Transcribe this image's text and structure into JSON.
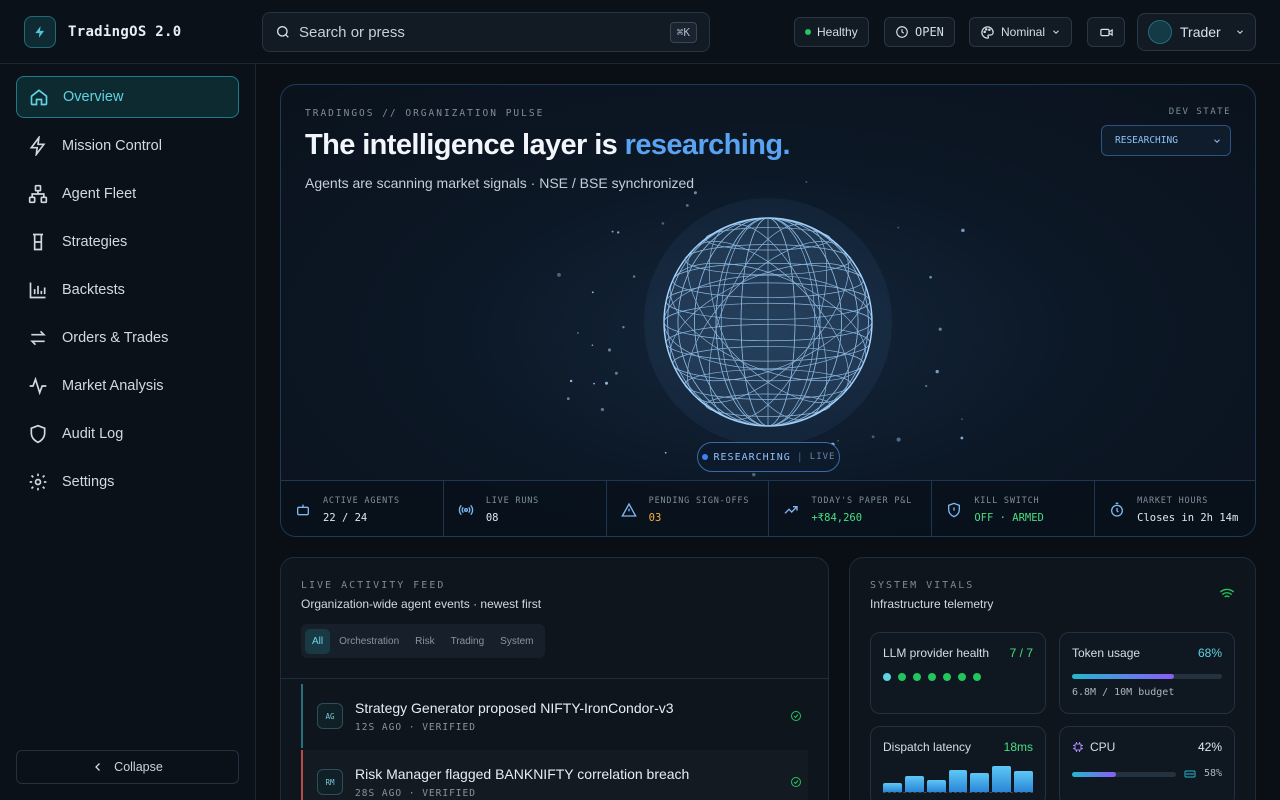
{
  "app": {
    "name": "TradingOS 2.0"
  },
  "search": {
    "placeholder": "Search or press",
    "shortcut": "⌘K"
  },
  "status": {
    "health": "Healthy",
    "market": "OPEN",
    "theme": "Nominal",
    "user": "Trader"
  },
  "sidebar": {
    "items": [
      {
        "label": "Overview",
        "icon": "home-icon",
        "active": true
      },
      {
        "label": "Mission Control",
        "icon": "bolt-icon"
      },
      {
        "label": "Agent Fleet",
        "icon": "network-icon"
      },
      {
        "label": "Strategies",
        "icon": "beaker-icon"
      },
      {
        "label": "Backtests",
        "icon": "bar-chart-icon"
      },
      {
        "label": "Orders & Trades",
        "icon": "swap-icon"
      },
      {
        "label": "Market Analysis",
        "icon": "activity-icon"
      },
      {
        "label": "Audit Log",
        "icon": "shield-icon"
      },
      {
        "label": "Settings",
        "icon": "gear-icon"
      }
    ],
    "collapse_label": "Collapse"
  },
  "hero": {
    "kicker": "TRADINGOS // ORGANIZATION PULSE",
    "title_main": "The intelligence layer is ",
    "title_accent": "researching.",
    "subtitle": "Agents are scanning market signals · NSE / BSE synchronized",
    "dev_state_label": "DEV STATE",
    "dev_state_value": "RESEARCHING",
    "status_chip": "RESEARCHING",
    "status_chip_live": "LIVE"
  },
  "metrics": [
    {
      "label": "ACTIVE AGENTS",
      "value": "22 / 24",
      "icon": "robot-icon",
      "color": "#dfe7ef"
    },
    {
      "label": "LIVE RUNS",
      "value": "08",
      "icon": "broadcast-icon",
      "color": "#dfe7ef"
    },
    {
      "label": "PENDING SIGN-OFFS",
      "value": "03",
      "icon": "alert-icon",
      "color": "#f5b13d"
    },
    {
      "label": "TODAY'S PAPER P&L",
      "value": "+₹84,260",
      "icon": "trend-up-icon",
      "color": "#4ade80"
    },
    {
      "label": "KILL SWITCH",
      "value": "OFF · ARMED",
      "icon": "shield-icon",
      "color": "#4ade80"
    },
    {
      "label": "MARKET HOURS",
      "value": "Closes in 2h 14m",
      "icon": "timer-icon",
      "color": "#dfe7ef"
    }
  ],
  "feed": {
    "kicker": "LIVE ACTIVITY FEED",
    "subtitle": "Organization-wide agent events · newest first",
    "tabs": [
      "All",
      "Orchestration",
      "Risk",
      "Trading",
      "System"
    ],
    "items": [
      {
        "badge": "AG",
        "title": "Strategy Generator proposed NIFTY-IronCondor-v3",
        "meta": "12S AGO · VERIFIED",
        "accent": "#2a6f7e"
      },
      {
        "badge": "RM",
        "title": "Risk Manager flagged BANKNIFTY correlation breach",
        "meta": "28S AGO · VERIFIED",
        "accent": "#b94a4a"
      }
    ]
  },
  "vitals": {
    "kicker": "SYSTEM VITALS",
    "subtitle": "Infrastructure telemetry",
    "llm": {
      "label": "LLM provider health",
      "value": "7 / 7",
      "up": 7
    },
    "tokens": {
      "label": "Token usage",
      "value": "68%",
      "fraction": 0.68,
      "budget": "6.8M / 10M budget"
    },
    "latency": {
      "label": "Dispatch latency",
      "value": "18ms",
      "bars": [
        0.35,
        0.6,
        0.45,
        0.8,
        0.72,
        0.95,
        0.78
      ]
    },
    "cpu": {
      "label": "CPU",
      "value": "42%",
      "fraction": 0.42,
      "secondary": "58%"
    }
  }
}
